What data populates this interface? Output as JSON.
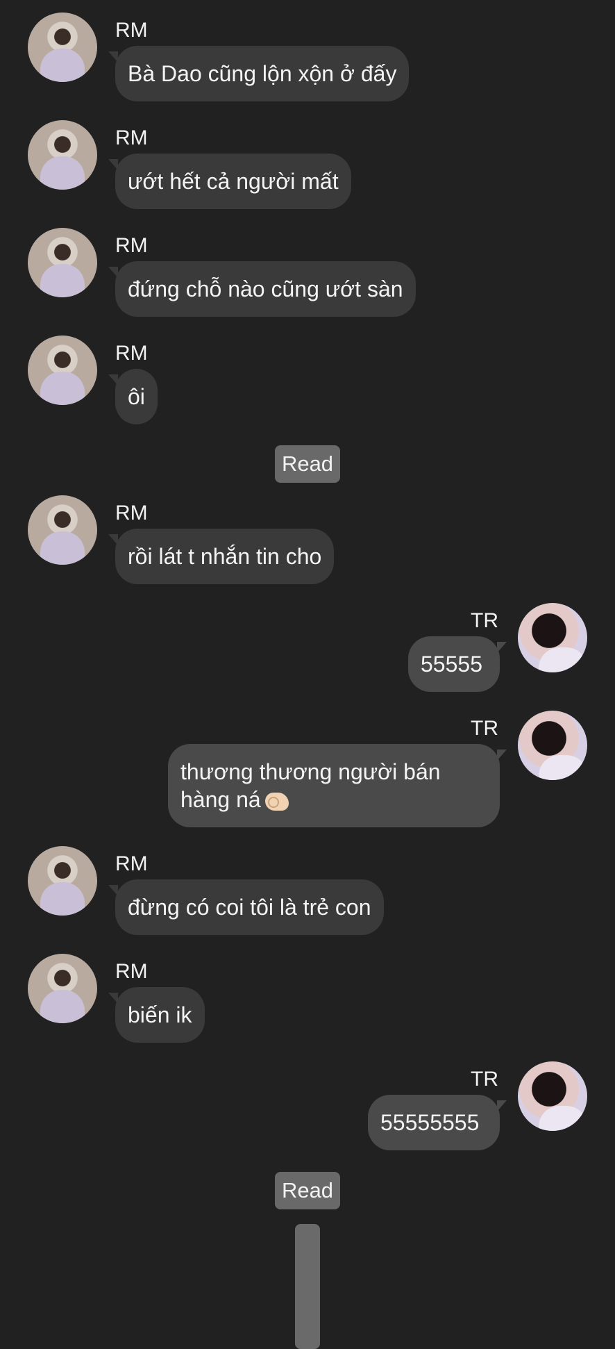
{
  "messages": [
    {
      "sender": "RM",
      "text": "Bà Dao cũng lộn xộn ở đấy"
    },
    {
      "sender": "RM",
      "text": "ướt hết cả người mất"
    },
    {
      "sender": "RM",
      "text": "đứng chỗ nào cũng ướt sàn"
    },
    {
      "sender": "RM",
      "text": "ôi"
    },
    {
      "status": "Read"
    },
    {
      "sender": "RM",
      "text": "rồi lát t nhắn tin cho"
    },
    {
      "sender": "TR",
      "text": "55555"
    },
    {
      "sender": "TR",
      "text_line1": "thương thương người bán",
      "text_line2": "hàng ná"
    },
    {
      "sender": "RM",
      "text": "đừng có coi tôi là trẻ con"
    },
    {
      "sender": "RM",
      "text": "biến ik"
    },
    {
      "sender": "TR",
      "text": "55555555"
    },
    {
      "status": "Read"
    }
  ]
}
